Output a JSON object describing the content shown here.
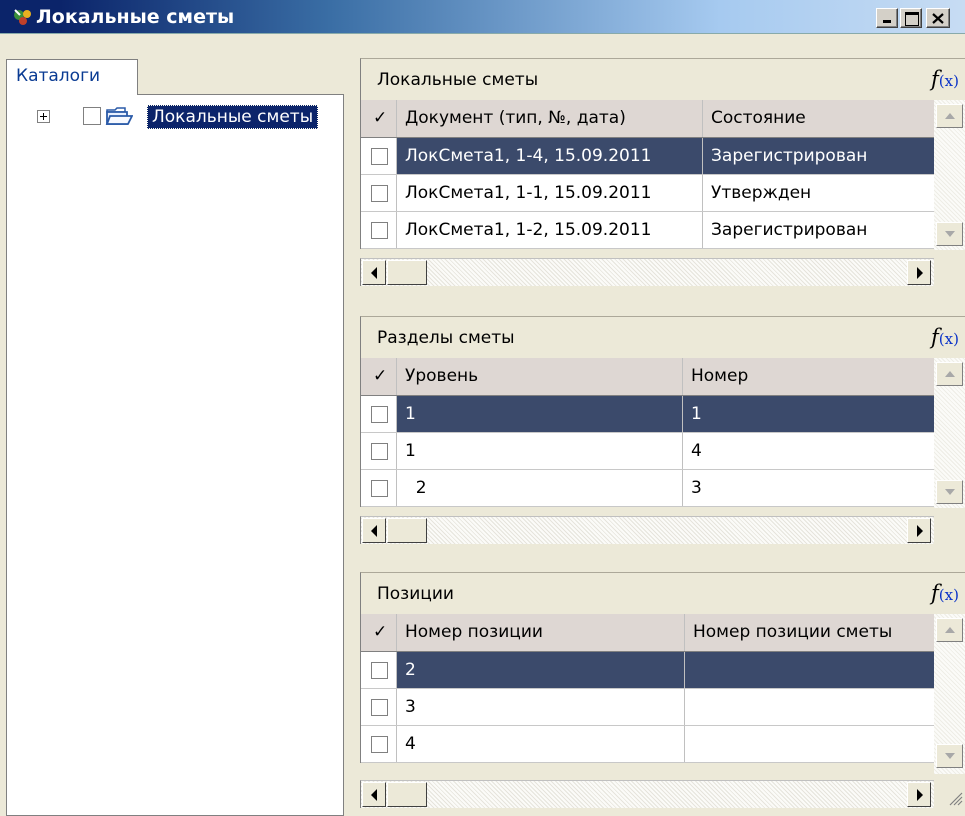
{
  "window": {
    "title": "Локальные сметы",
    "minimize_icon": "minimize-icon",
    "maximize_icon": "maximize-icon",
    "close_icon": "close-icon"
  },
  "left": {
    "tab_label": "Каталоги",
    "tree": [
      {
        "label": "Локальные сметы",
        "expanded": false,
        "checked": false,
        "selected": true
      }
    ]
  },
  "panels": {
    "smety": {
      "title": "Локальные сметы",
      "fx_label": "f(x)",
      "columns": [
        "Документ (тип, №, дата)",
        "Состояние"
      ],
      "rows": [
        {
          "cells": [
            "ЛокСмета1, 1-4, 15.09.2011",
            "Зарегистрирован"
          ],
          "selected": true
        },
        {
          "cells": [
            "ЛокСмета1, 1-1, 15.09.2011",
            "Утвержден"
          ],
          "selected": false
        },
        {
          "cells": [
            "ЛокСмета1, 1-2, 15.09.2011",
            "Зарегистрирован"
          ],
          "selected": false
        }
      ]
    },
    "razdely": {
      "title": "Разделы сметы",
      "fx_label": "f(x)",
      "columns": [
        "Уровень",
        "Номер"
      ],
      "rows": [
        {
          "cells": [
            "1",
            "1"
          ],
          "selected": true
        },
        {
          "cells": [
            "1",
            "4"
          ],
          "selected": false
        },
        {
          "cells": [
            "  2",
            "3"
          ],
          "selected": false
        }
      ]
    },
    "pozicii": {
      "title": "Позиции",
      "fx_label": "f(x)",
      "columns": [
        "Номер позиции",
        "Номер позиции сметы"
      ],
      "rows": [
        {
          "cells": [
            "2",
            ""
          ],
          "selected": true
        },
        {
          "cells": [
            "3",
            ""
          ],
          "selected": false
        },
        {
          "cells": [
            "4",
            ""
          ],
          "selected": false
        }
      ]
    }
  },
  "colors": {
    "title_bar_dark": "#0b246a",
    "selection": "#3b4a6b",
    "header_bg": "#ded7d3",
    "tab_text": "#0a3b93"
  }
}
